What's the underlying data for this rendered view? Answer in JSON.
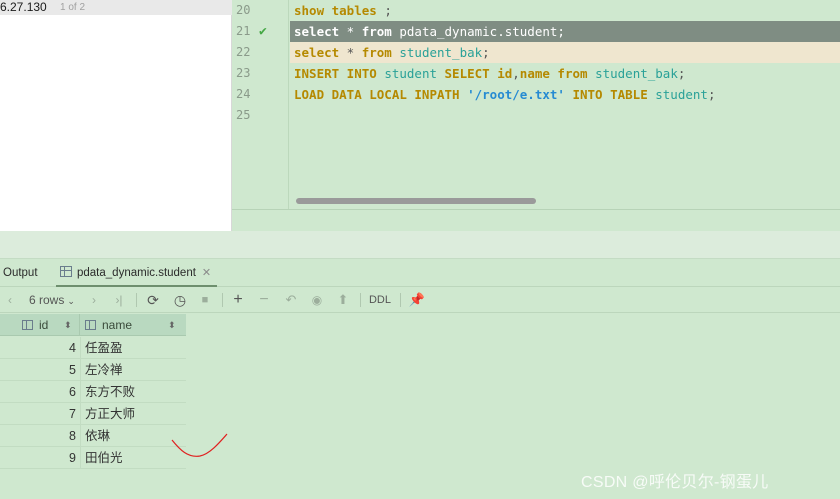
{
  "connection": {
    "host": "6.27.130",
    "count": "1 of 2"
  },
  "editor": {
    "lines": [
      {
        "number": "20",
        "tokens": [
          {
            "t": "kw",
            "v": "show tables"
          },
          {
            "t": "pl",
            "v": " ;"
          }
        ]
      },
      {
        "number": "21",
        "tokens": [
          {
            "t": "kw",
            "v": "select"
          },
          {
            "t": "pl",
            "v": " * "
          },
          {
            "t": "kw",
            "v": "from"
          },
          {
            "t": "pl",
            "v": " pdata_dynamic.student;"
          }
        ]
      },
      {
        "number": "22",
        "tokens": [
          {
            "t": "kw",
            "v": "select"
          },
          {
            "t": "pl",
            "v": " * "
          },
          {
            "t": "kw",
            "v": "from"
          },
          {
            "t": "id",
            "v": " student_bak"
          },
          {
            "t": "pl",
            "v": ";"
          }
        ]
      },
      {
        "number": "23",
        "tokens": [
          {
            "t": "kw",
            "v": "INSERT INTO"
          },
          {
            "t": "id",
            "v": " student "
          },
          {
            "t": "kw",
            "v": "SELECT"
          },
          {
            "t": "kw",
            "v": " id"
          },
          {
            "t": "pl",
            "v": ","
          },
          {
            "t": "kw",
            "v": "name"
          },
          {
            "t": "kw",
            "v": " from"
          },
          {
            "t": "id",
            "v": " student_bak"
          },
          {
            "t": "pl",
            "v": ";"
          }
        ]
      },
      {
        "number": "24",
        "tokens": [
          {
            "t": "kw",
            "v": "LOAD DATA LOCAL INPATH"
          },
          {
            "t": "str",
            "v": " '/root/e.txt'"
          },
          {
            "t": "kw",
            "v": " INTO TABLE"
          },
          {
            "t": "id",
            "v": " student"
          },
          {
            "t": "pl",
            "v": ";"
          }
        ]
      },
      {
        "number": "25",
        "tokens": []
      }
    ]
  },
  "tabs": {
    "output": "Output",
    "table": "pdata_dynamic.student"
  },
  "toolbar": {
    "rows": "6 rows",
    "ddl": "DDL"
  },
  "grid": {
    "columns": [
      "id",
      "name"
    ],
    "rows": [
      {
        "id": "4",
        "name": "任盈盈"
      },
      {
        "id": "5",
        "name": "左冷禅"
      },
      {
        "id": "6",
        "name": "东方不败"
      },
      {
        "id": "7",
        "name": "方正大师"
      },
      {
        "id": "8",
        "name": "依琳"
      },
      {
        "id": "9",
        "name": "田伯光"
      }
    ]
  },
  "watermark": "CSDN @呼伦贝尔-钢蛋儿"
}
